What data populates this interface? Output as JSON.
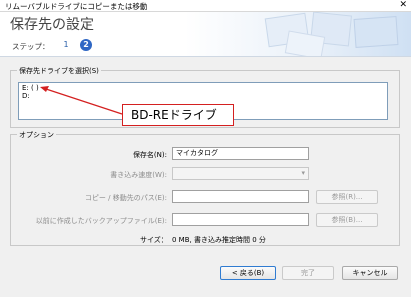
{
  "window": {
    "title": "リムーバブルドライブにコピーまたは移動",
    "close_glyph": "✕"
  },
  "header": {
    "title": "保存先の設定",
    "step_label": "ステップ：",
    "steps": [
      "1",
      "2"
    ],
    "active_step": "2"
  },
  "drive_group": {
    "label": "保存先ドライブを選択(S)",
    "drives": [
      "E: ( )",
      "D:"
    ]
  },
  "callout": {
    "text": "BD-REドライブ"
  },
  "options": {
    "label": "オプション",
    "save_name": {
      "label": "保存名(N):",
      "value": "マイカタログ"
    },
    "write_speed": {
      "label": "書き込み速度(W):",
      "value": ""
    },
    "copy_path": {
      "label": "コピー / 移動先のパス(E):",
      "value": "",
      "browse_label": "参照(R)..."
    },
    "backup_file": {
      "label": "以前に作成したバックアップファイル(E):",
      "value": "",
      "browse_label": "参照(B)..."
    },
    "size_label": "サイズ：",
    "size_value": "0 MB, 書き込み推定時間 0 分"
  },
  "footer": {
    "back_label": "< 戻る(B)",
    "finish_label": "完了",
    "cancel_label": "キャンセル"
  },
  "colors": {
    "accent": "#2f67c4",
    "callout_border": "#d42020"
  }
}
